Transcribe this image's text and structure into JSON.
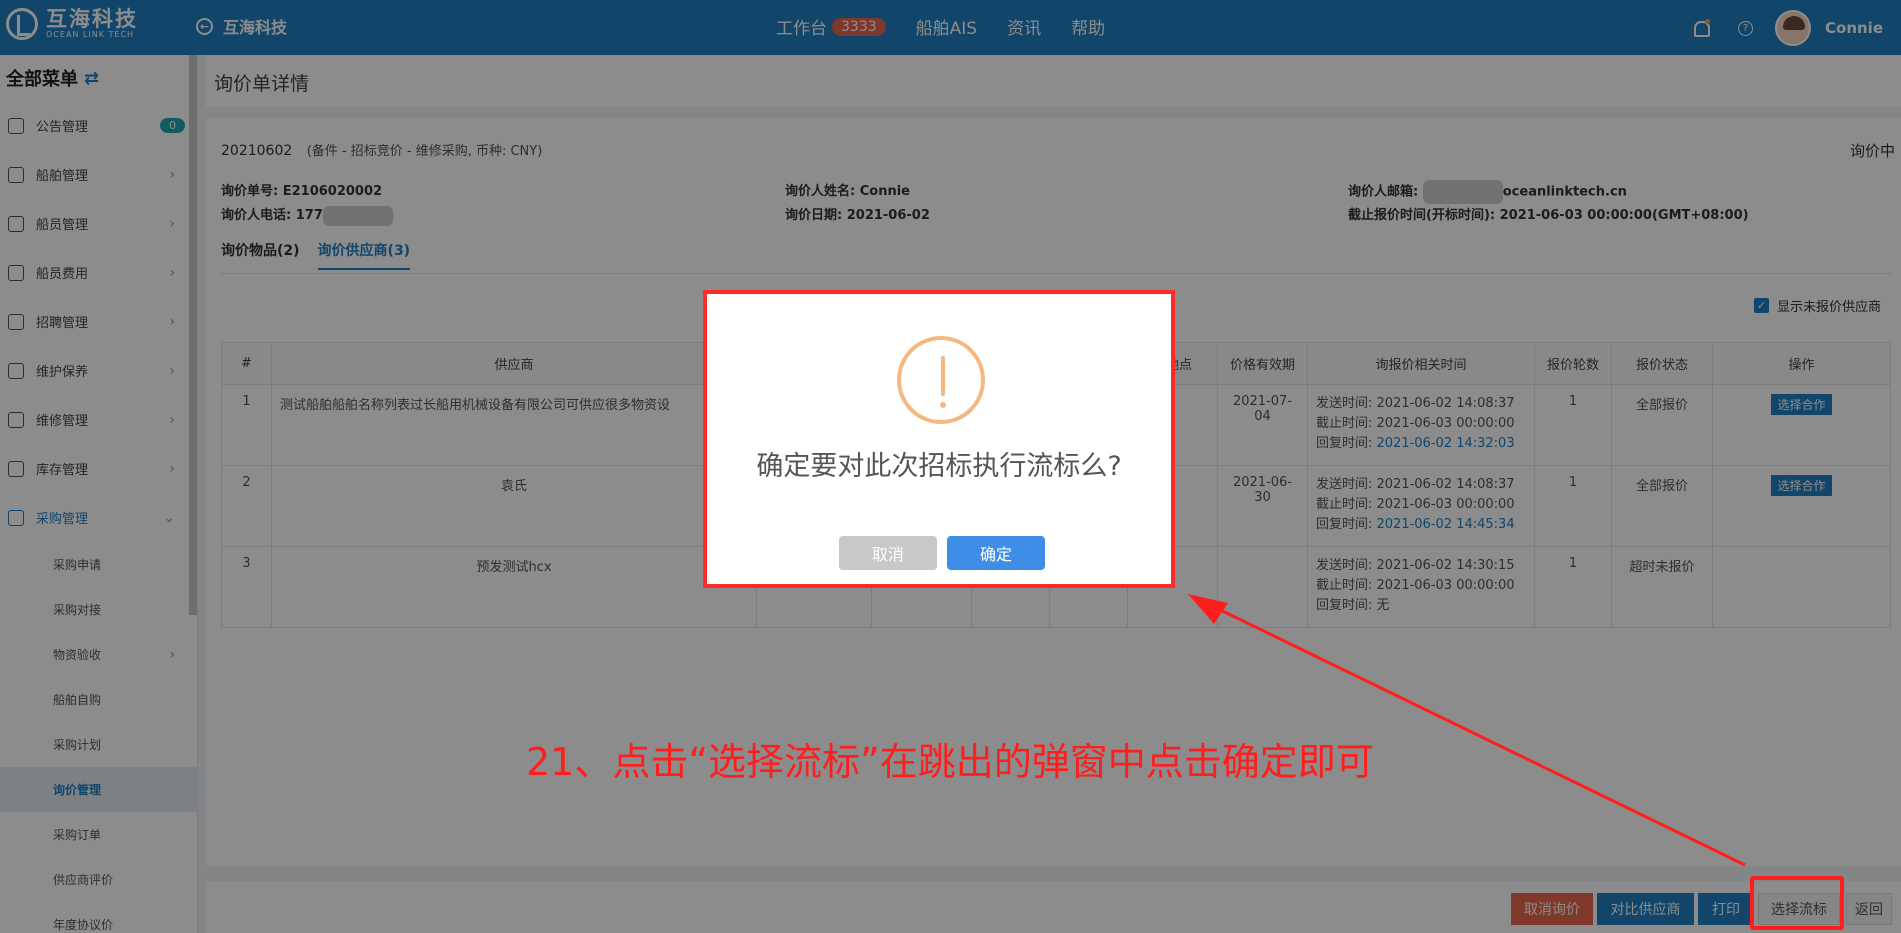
{
  "brand": {
    "name_cn": "互海科技",
    "name_en": "OCEAN LINK TECH"
  },
  "header": {
    "back_label": "互海科技",
    "workbench": "工作台",
    "workbench_count": "3333",
    "ais": "船舶AIS",
    "news": "资讯",
    "help": "帮助",
    "user": "Connie"
  },
  "sidebar": {
    "title": "全部菜单",
    "swap_icon": "⇄",
    "notice": {
      "label": "公告管理",
      "count": "0"
    },
    "items": [
      "船舶管理",
      "船员管理",
      "船员费用",
      "招聘管理",
      "维护保养",
      "维修管理",
      "库存管理"
    ],
    "purchase": "采购管理",
    "sub_items": [
      "采购申请",
      "采购对接",
      "物资验收",
      "船舶自购",
      "采购计划",
      "询价管理",
      "采购订单",
      "供应商评价",
      "年度协议价"
    ]
  },
  "page": {
    "title": "询价单详情"
  },
  "inquiry": {
    "number": "20210602",
    "meta": "(备件 - 招标竞价 - 维修采购, 币种: CNY)",
    "status": "询价中",
    "order_no": "询价单号: E2106020002",
    "phone": "询价人电话: 177",
    "name": "询价人姓名: Connie",
    "date": "询价日期: 2021-06-02",
    "email_label": "询价人邮箱:",
    "email_suffix": "oceanlinktech.cn",
    "deadline": "截止报价时间(开标时间): 2021-06-03 00:00:00(GMT+08:00)"
  },
  "tabs": [
    "询价物品(2)",
    "询价供应商(3)"
  ],
  "show_unquoted": "显示未报价供应商",
  "table": {
    "headers": [
      "#",
      "供应商",
      "",
      "",
      "",
      "",
      "货地点",
      "价格有效期",
      "询报价相关时间",
      "报价轮数",
      "报价状态",
      "操作"
    ],
    "rows": [
      {
        "no": "1",
        "supplier": "测试船舶船舶名称列表过长船用机械设备有限公司可供应很多物资设",
        "validity": "2021-07-04",
        "sent": "发送时间: 2021-06-02 14:08:37",
        "deadline": "截止时间: 2021-06-03 00:00:00",
        "reply_label": "回复时间: ",
        "reply": "2021-06-02 14:32:03",
        "rounds": "1",
        "status": "全部报价",
        "op": "选择合作"
      },
      {
        "no": "2",
        "supplier": "袁氏",
        "validity": "2021-06-30",
        "sent": "发送时间: 2021-06-02 14:08:37",
        "deadline": "截止时间: 2021-06-03 00:00:00",
        "reply_label": "回复时间: ",
        "reply": "2021-06-02 14:45:34",
        "rounds": "1",
        "status": "全部报价",
        "op": "选择合作"
      },
      {
        "no": "3",
        "supplier": "预发测试hcx",
        "validity": "",
        "sent": "发送时间: 2021-06-02 14:30:15",
        "deadline": "截止时间: 2021-06-03 00:00:00",
        "reply_label": "回复时间: ",
        "reply": "无",
        "rounds": "1",
        "status": "超时未报价",
        "op": ""
      }
    ]
  },
  "footer": {
    "cancel": "取消询价",
    "compare": "对比供应商",
    "print": "打印",
    "fail": "选择流标",
    "back": "返回"
  },
  "modal": {
    "message": "确定要对此次招标执行流标么?",
    "cancel": "取消",
    "confirm": "确定"
  },
  "annotation": "21、点击“选择流标”在跳出的弹窗中点击确定即可",
  "colors": {
    "primary": "#1f7fc1",
    "danger": "#e8664c",
    "annotation": "#ff1e1e",
    "warning": "#f5b880"
  }
}
